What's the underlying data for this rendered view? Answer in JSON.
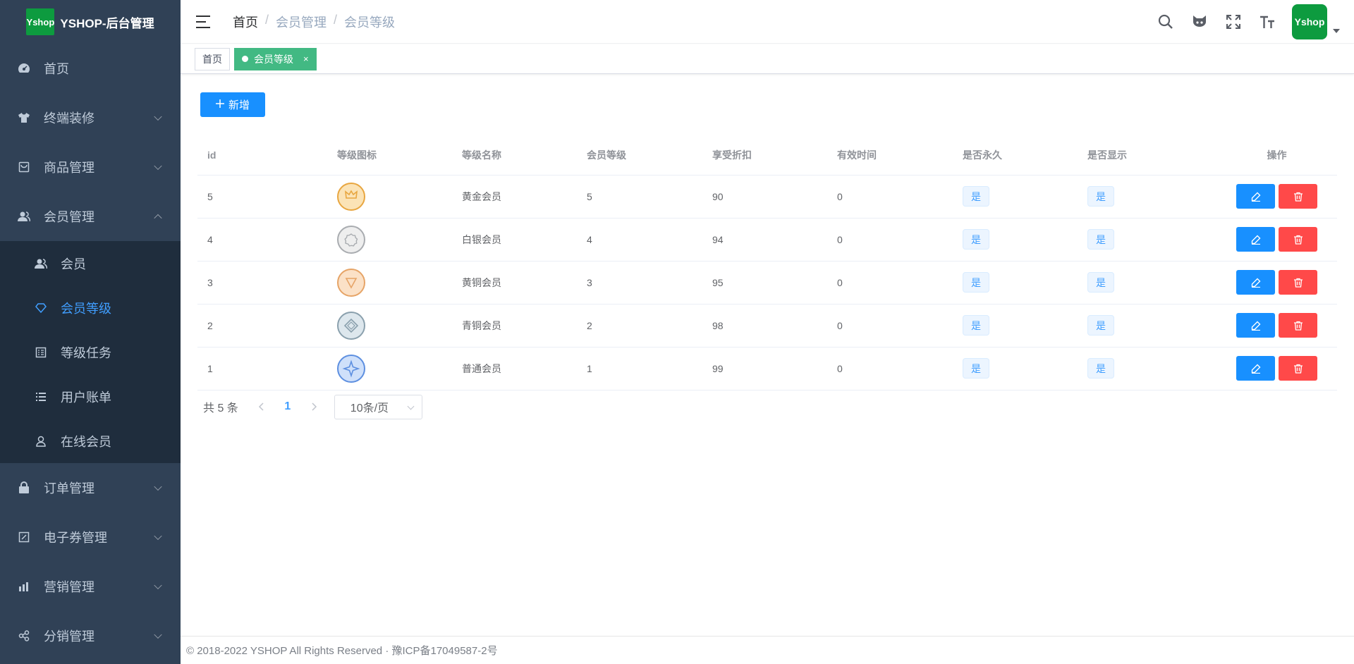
{
  "app": {
    "logo_text": "Yshop",
    "title": "YSHOP-后台管理"
  },
  "sidebar": {
    "items": [
      {
        "label": "首页",
        "icon": "dashboard-icon"
      },
      {
        "label": "终端装修",
        "icon": "shirt-icon",
        "expandable": true
      },
      {
        "label": "商品管理",
        "icon": "shop-icon",
        "expandable": true
      },
      {
        "label": "会员管理",
        "icon": "peoples-icon",
        "expandable": true,
        "expanded": true,
        "children": [
          {
            "label": "会员",
            "icon": "peoples-icon"
          },
          {
            "label": "会员等级",
            "icon": "diamond-icon",
            "active": true
          },
          {
            "label": "等级任务",
            "icon": "task-icon"
          },
          {
            "label": "用户账单",
            "icon": "list-icon"
          },
          {
            "label": "在线会员",
            "icon": "online-icon"
          }
        ]
      },
      {
        "label": "订单管理",
        "icon": "lock-icon",
        "expandable": true
      },
      {
        "label": "电子券管理",
        "icon": "coupon-icon",
        "expandable": true
      },
      {
        "label": "营销管理",
        "icon": "chart-icon",
        "expandable": true
      },
      {
        "label": "分销管理",
        "icon": "share-icon",
        "expandable": true
      }
    ]
  },
  "navbar": {
    "breadcrumb": [
      "首页",
      "会员管理",
      "会员等级"
    ],
    "avatar_text": "Yshop"
  },
  "tags": {
    "home": "首页",
    "active": "会员等级",
    "close": "×"
  },
  "toolbar": {
    "add_label": "新增"
  },
  "table": {
    "headers": [
      "id",
      "等级图标",
      "等级名称",
      "会员等级",
      "享受折扣",
      "有效时间",
      "是否永久",
      "是否显示",
      "操作"
    ],
    "rows": [
      {
        "id": "5",
        "name": "黄金会员",
        "grade": "5",
        "discount": "90",
        "valid_days": "0",
        "permanent": "是",
        "show": "是",
        "icon_color": "#e8a640",
        "icon_bg": "#fbe3b6"
      },
      {
        "id": "4",
        "name": "白银会员",
        "grade": "4",
        "discount": "94",
        "valid_days": "0",
        "permanent": "是",
        "show": "是",
        "icon_color": "#a9acb0",
        "icon_bg": "#eeeeee"
      },
      {
        "id": "3",
        "name": "黄铜会员",
        "grade": "3",
        "discount": "95",
        "valid_days": "0",
        "permanent": "是",
        "show": "是",
        "icon_color": "#e6a467",
        "icon_bg": "#fbe1c7"
      },
      {
        "id": "2",
        "name": "青铜会员",
        "grade": "2",
        "discount": "98",
        "valid_days": "0",
        "permanent": "是",
        "show": "是",
        "icon_color": "#8aa0ad",
        "icon_bg": "#dde7ed"
      },
      {
        "id": "1",
        "name": "普通会员",
        "grade": "1",
        "discount": "99",
        "valid_days": "0",
        "permanent": "是",
        "show": "是",
        "icon_color": "#5d8fe0",
        "icon_bg": "#cfe0fa"
      }
    ]
  },
  "pagination": {
    "total_text": "共 5 条",
    "current_page": "1",
    "page_size": "10条/页"
  },
  "footer": {
    "text": "© 2018-2022 YSHOP All Rights Reserved · 豫ICP备17049587-2号"
  },
  "colors": {
    "sidebar_bg": "#304156",
    "submenu_bg": "#1f2d3d",
    "primary": "#1890ff",
    "danger": "#ff4949",
    "tag_active": "#42b983",
    "active_text": "#409eff"
  }
}
